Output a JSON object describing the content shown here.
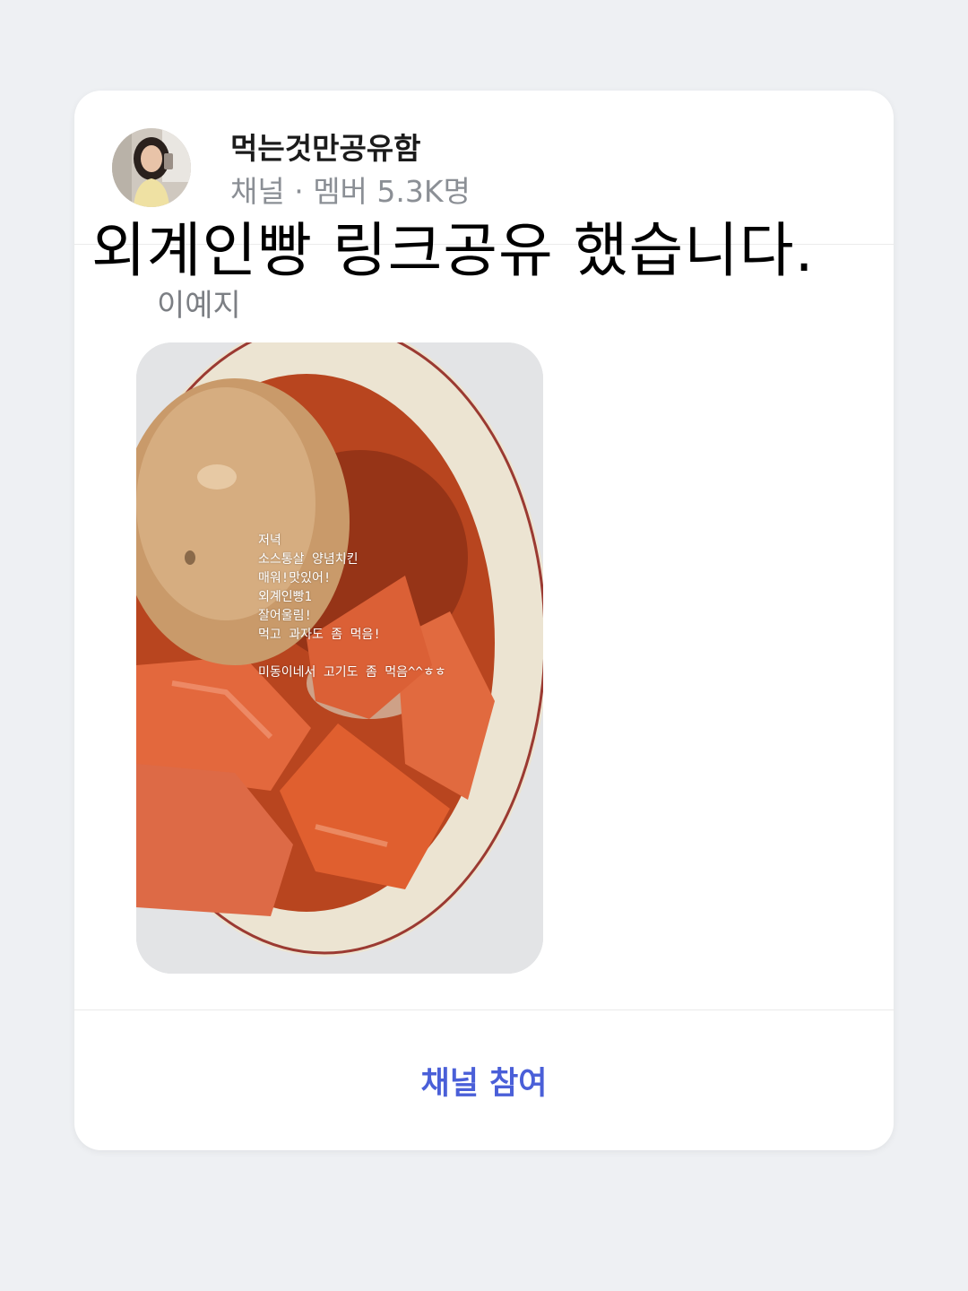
{
  "channel": {
    "name": "먹는것만공유함",
    "meta": "채널 · 멤버 5.3K명"
  },
  "caption": "외계인빵  링크공유  했습니다.",
  "message": {
    "sender": "이예지",
    "photo_overlay_lines": [
      "저녁",
      "소스통살 양념치킨",
      "매워!맛있어!",
      "외계인빵1",
      "잘어울림!",
      "먹고 과자도 좀 먹음!",
      "",
      "미동이네서 고기도 좀 먹음^^ㅎㅎ"
    ]
  },
  "actions": {
    "join_label": "채널 참여"
  },
  "colors": {
    "accent": "#4a5fd8",
    "background": "#eef0f3",
    "card": "#ffffff",
    "muted_text": "#8b8f95"
  }
}
